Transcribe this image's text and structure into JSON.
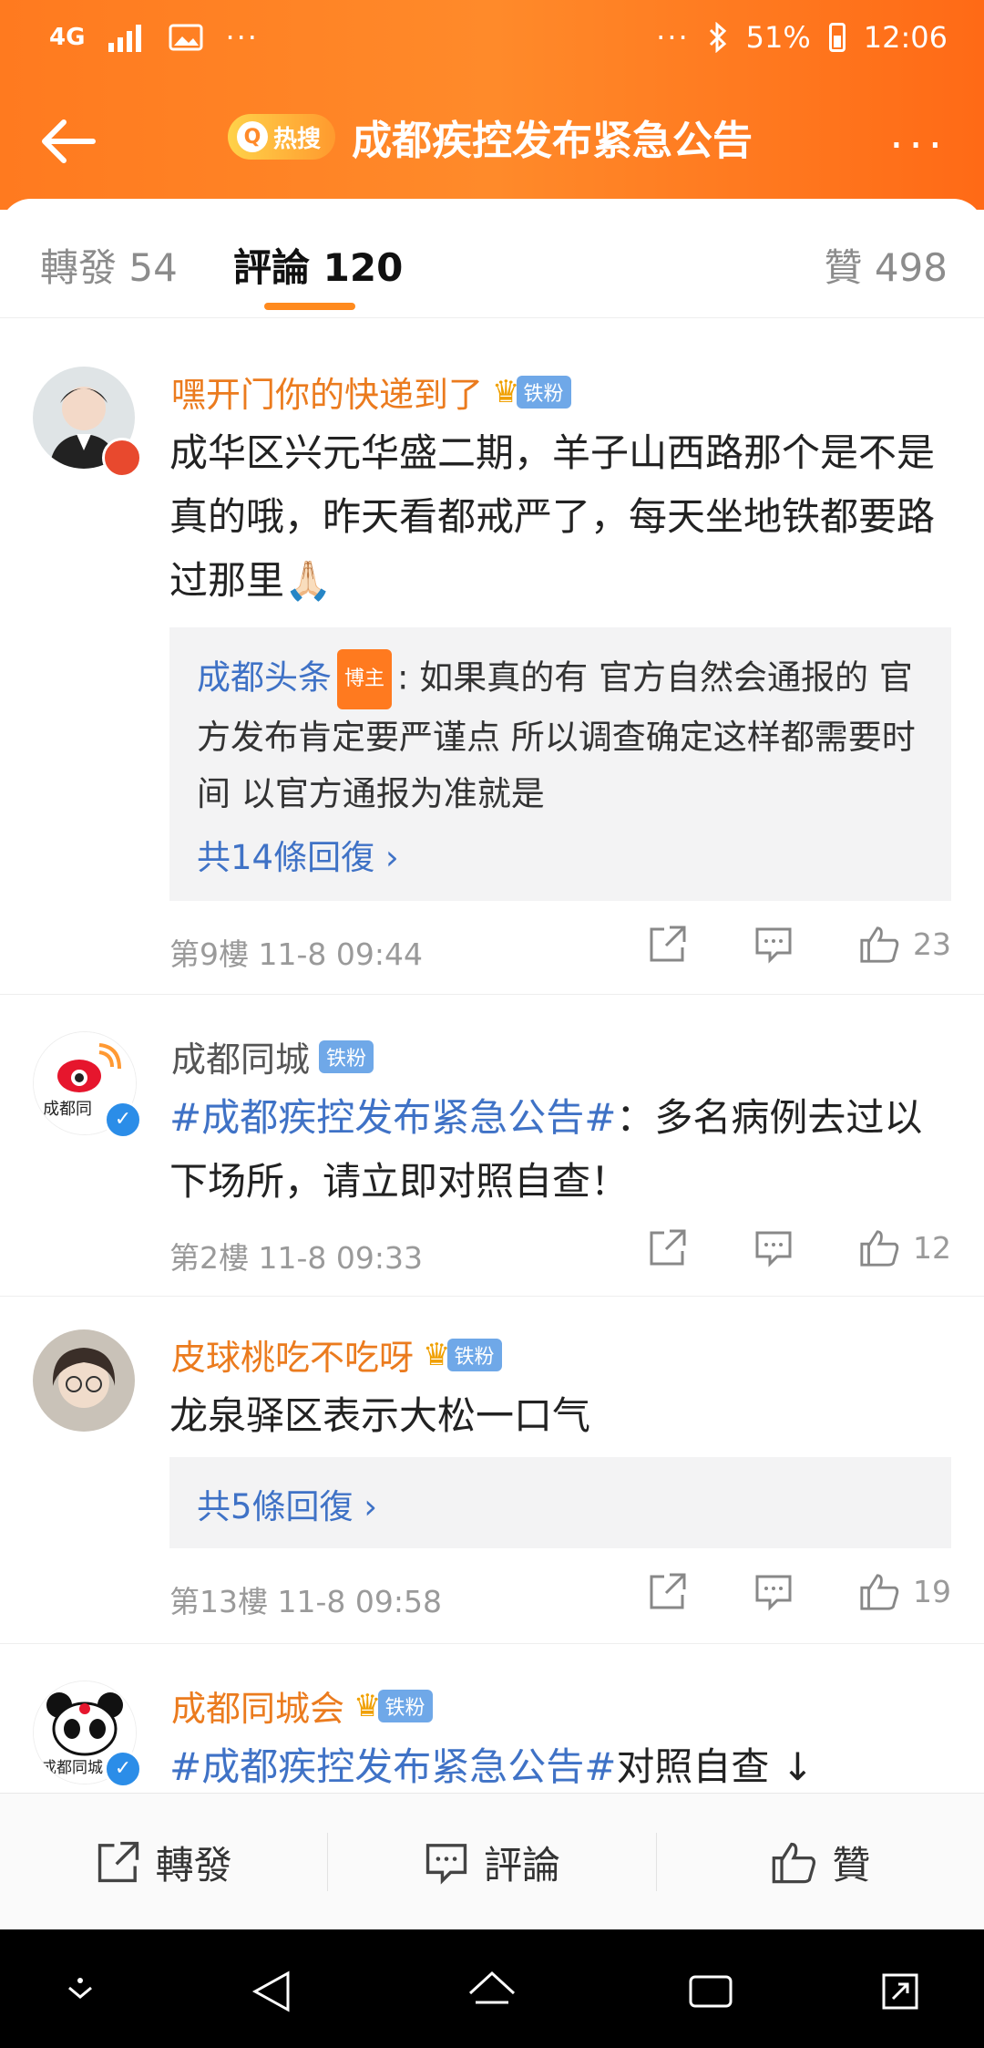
{
  "status": {
    "network": "4G",
    "battery_percent": "51%",
    "time": "12:06",
    "dots": "···"
  },
  "header": {
    "hot_badge_label": "热搜",
    "title": "成都疾控发布紧急公告",
    "more": "···"
  },
  "tabs": {
    "repost": "轉發 54",
    "comments": "評論 120",
    "likes": "贊 498"
  },
  "comments": [
    {
      "username": "嘿开门你的快递到了",
      "badge": "铁粉",
      "text": "成华区兴元华盛二期，羊子山西路那个是不是真的哦，昨天看都戒严了，每天坐地铁都要路过那里🙏🏻",
      "reply": {
        "name": "成都头条",
        "role_badge": "博主",
        "text": ": 如果真的有 官方自然会通报的 官方发布肯定要严谨点 所以调查确定这样都需要时间 以官方通报为准就是"
      },
      "more_replies": "共14條回復 ›",
      "floor_time": "第9樓  11-8 09:44",
      "likes": "23"
    },
    {
      "username": "成都同城",
      "badge": "铁粉",
      "topic": "#成都疾控发布紧急公告#",
      "text": "：多名病例去过以下场所，请立即对照自查！",
      "avatar_text": "成都同",
      "floor_time": "第2樓  11-8 09:33",
      "likes": "12"
    },
    {
      "username": "皮球桃吃不吃呀",
      "badge": "铁粉",
      "text": "龙泉驿区表示大松一口气",
      "more_replies": "共5條回復 ›",
      "floor_time": "第13樓  11-8 09:58",
      "likes": "19"
    },
    {
      "username": "成都同城会",
      "badge": "铁粉",
      "topic": "#成都疾控发布紧急公告#",
      "text": "对照自查 ↓",
      "avatar_text": "成都同城"
    }
  ],
  "bottom_bar": {
    "repost": "轉發",
    "comment": "評論",
    "like": "贊"
  },
  "colors": {
    "header_orange": "#ff7a1f",
    "username_orange": "#eb7b1e",
    "link_blue": "#3f72c6",
    "fan_badge_blue": "#6fa8e8"
  }
}
